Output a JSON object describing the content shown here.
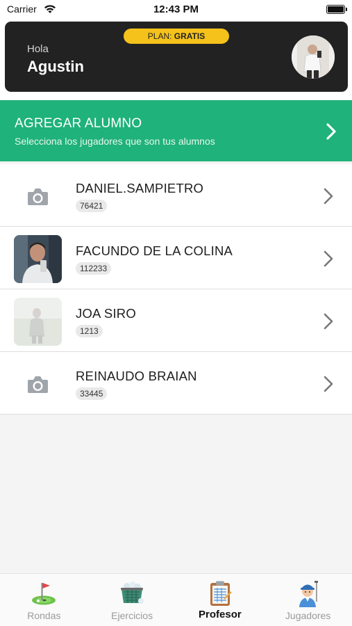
{
  "status_bar": {
    "carrier": "Carrier",
    "time": "12:43 PM"
  },
  "header": {
    "plan_prefix": "PLAN: ",
    "plan_value": "GRATIS",
    "greeting": "Hola",
    "user_name": "Agustin",
    "accent_color": "#f5c21b"
  },
  "add_student": {
    "title": "AGREGAR ALUMNO",
    "subtitle": "Selecciona los jugadores que son tus alumnos",
    "color": "#1fb27a"
  },
  "students": [
    {
      "name": "DANIEL.SAMPIETRO",
      "id": "76421",
      "avatar": "camera-placeholder"
    },
    {
      "name": "FACUNDO DE LA COLINA",
      "id": "112233",
      "avatar": "photo"
    },
    {
      "name": "JOA SIRO",
      "id": "1213",
      "avatar": "photo-faded"
    },
    {
      "name": "REINAUDO BRAIAN",
      "id": "33445",
      "avatar": "camera-placeholder"
    }
  ],
  "tabs": [
    {
      "label": "Rondas",
      "icon": "golf-flag-icon",
      "active": false
    },
    {
      "label": "Ejercicios",
      "icon": "ball-basket-icon",
      "active": false
    },
    {
      "label": "Profesor",
      "icon": "clipboard-icon",
      "active": true
    },
    {
      "label": "Jugadores",
      "icon": "golfer-icon",
      "active": false
    }
  ]
}
